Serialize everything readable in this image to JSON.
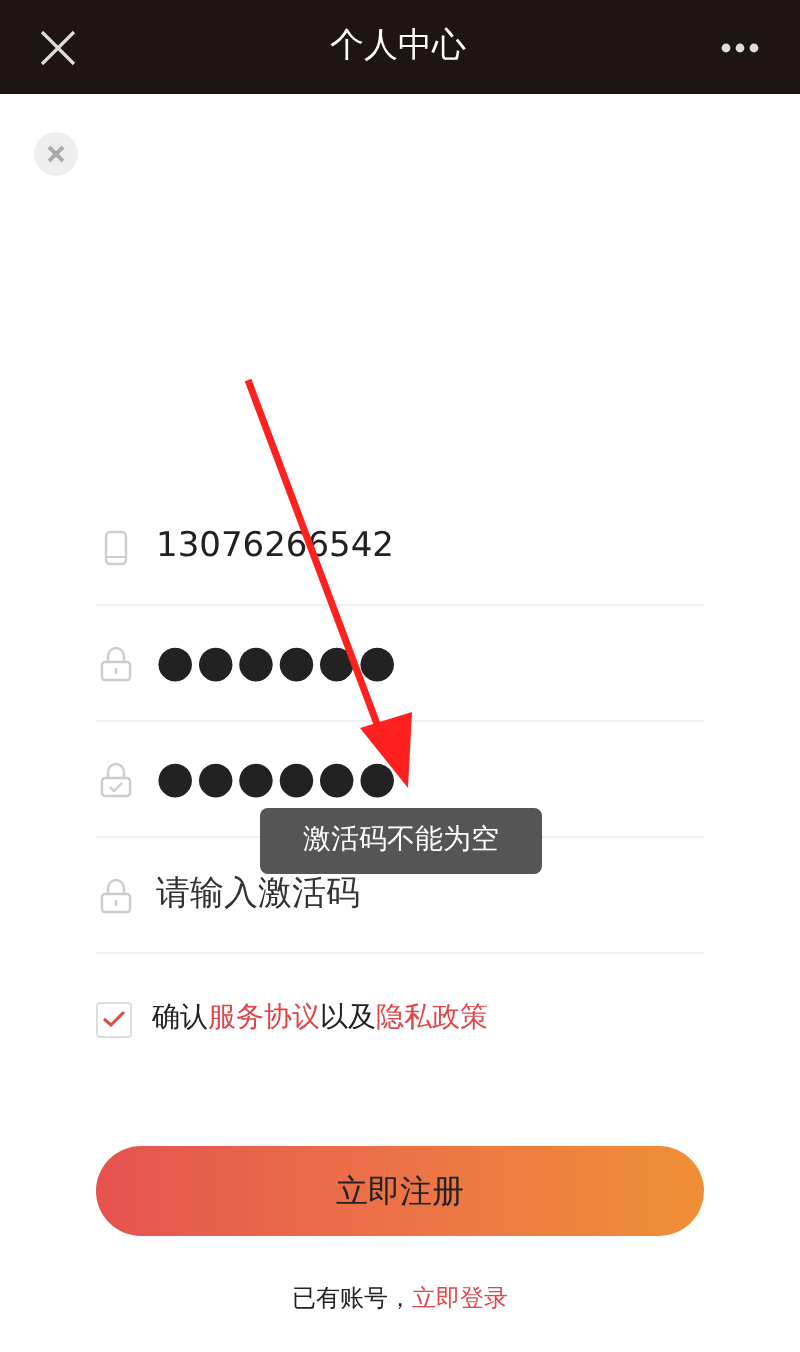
{
  "header": {
    "title": "个人中心"
  },
  "fields": [
    {
      "kind": "phone",
      "value": "13076266542"
    },
    {
      "kind": "password",
      "value": "●●●●●●"
    },
    {
      "kind": "confirm",
      "value": "●●●●●●"
    },
    {
      "kind": "code",
      "placeholder": "请输入激活码"
    }
  ],
  "agreement": {
    "checked": true,
    "text_1": "确认",
    "link_1": "服务协议",
    "text_2": "以及",
    "link_2": "隐私政策"
  },
  "submit": "立即注册",
  "footer": {
    "text": "已有账号，",
    "link": "立即登录"
  },
  "toast": "激活码不能为空"
}
